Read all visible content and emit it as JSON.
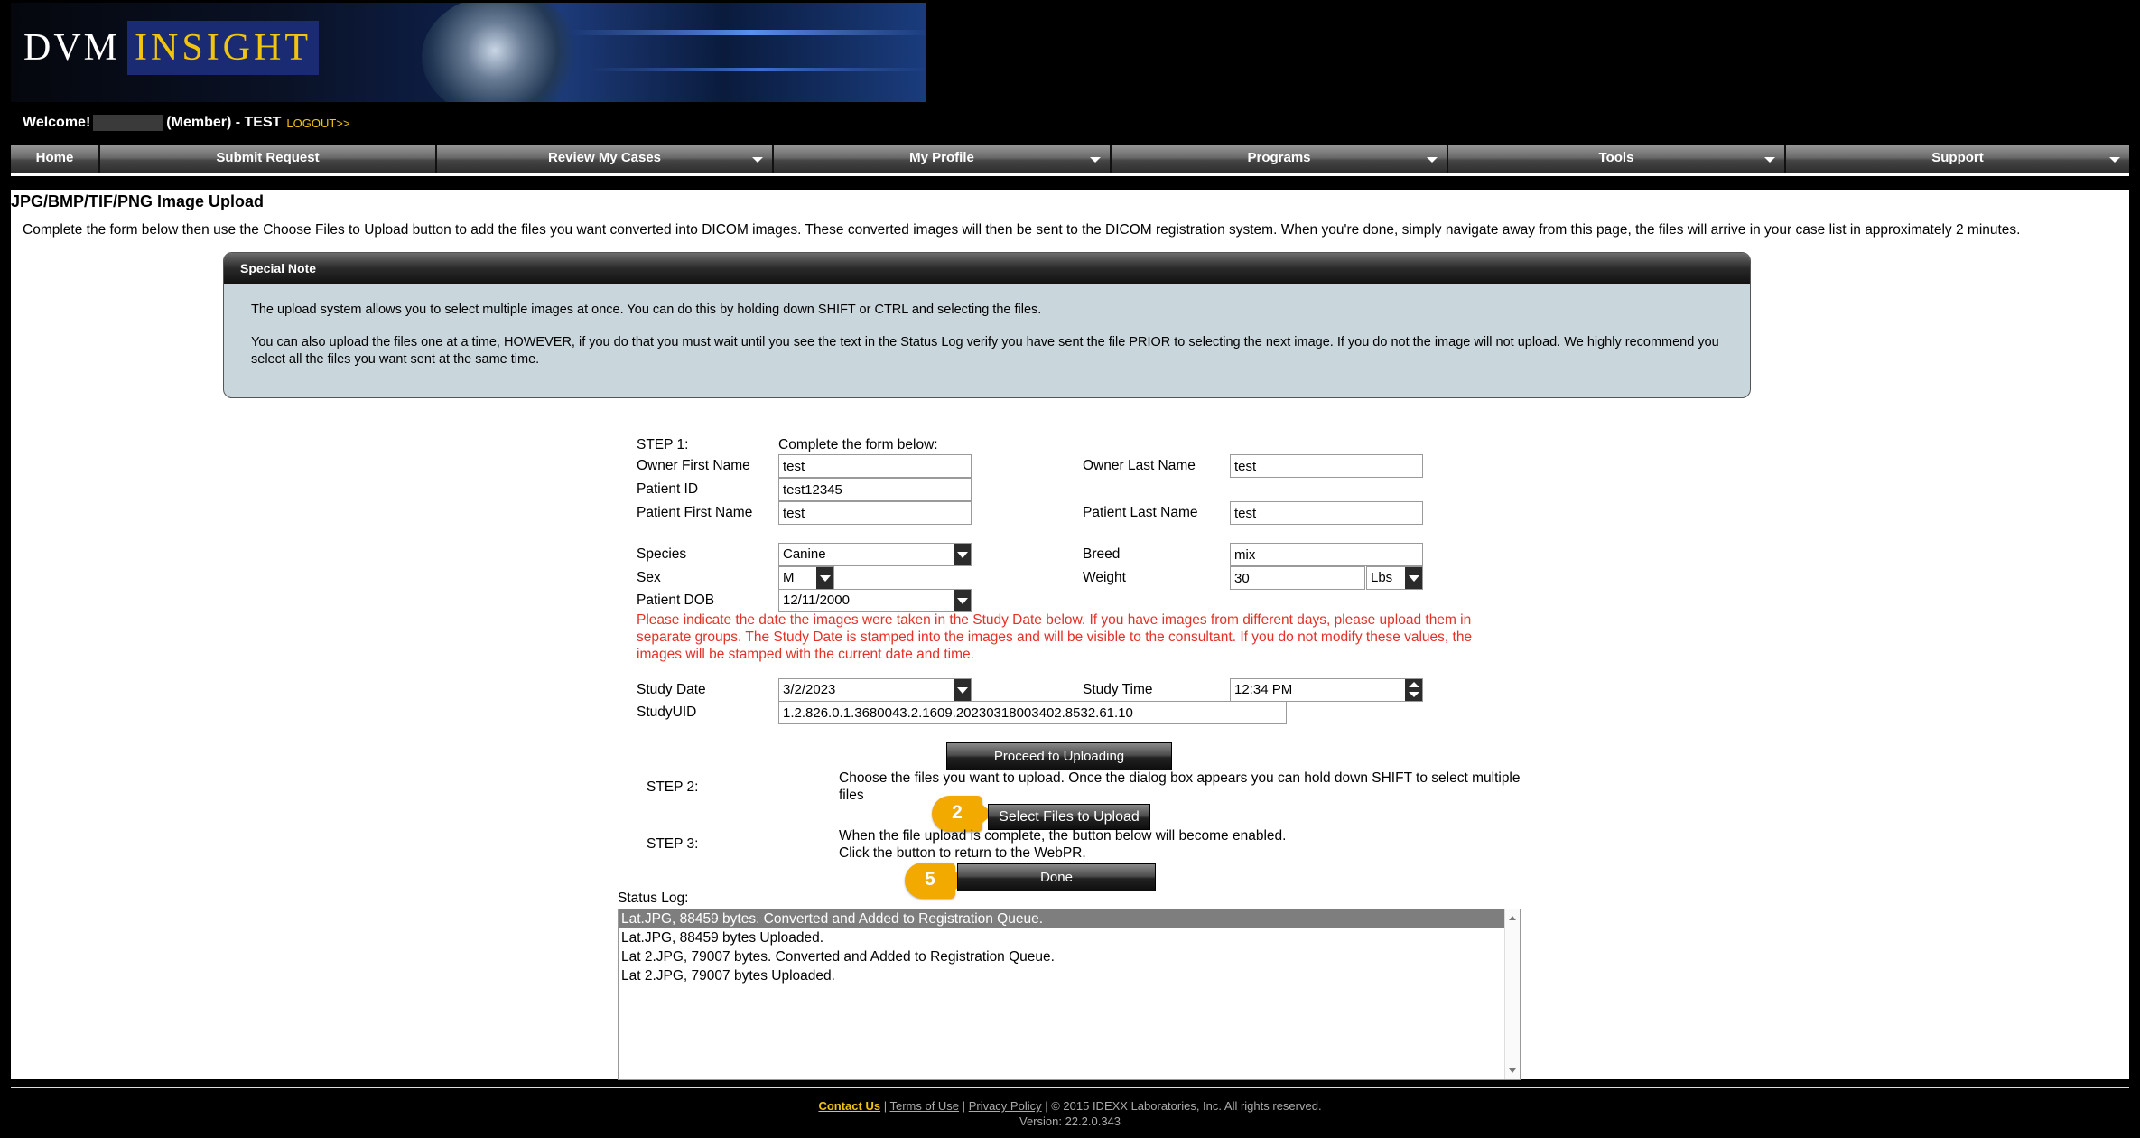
{
  "header": {
    "logo_left": "DVM",
    "logo_right": "INSIGHT",
    "welcome": "Welcome!",
    "member_text": "(Member) - TEST",
    "logout": "LOGOUT>>"
  },
  "nav": {
    "items": [
      {
        "label": "Home"
      },
      {
        "label": "Submit Request"
      },
      {
        "label": "Review My Cases"
      },
      {
        "label": "My Profile"
      },
      {
        "label": "Programs"
      },
      {
        "label": "Tools"
      },
      {
        "label": "Support"
      }
    ]
  },
  "page": {
    "title": "JPG/BMP/TIF/PNG Image Upload",
    "intro": "Complete the form below then use the Choose Files to Upload button to add the files you want converted into DICOM images. These converted images will then be sent to the DICOM registration system. When you're done, simply navigate away from this page, the files will arrive in your case list in approximately 2 minutes."
  },
  "note": {
    "title": "Special Note",
    "para1": "The upload system allows you to select multiple images at once. You can do this by holding down SHIFT or CTRL and selecting the files.",
    "para2": "You can also upload the files one at a time, HOWEVER, if you do that you must wait until you see the text in the Status Log verify you have sent the file PRIOR to selecting the next image. If you do not the image will not upload.   We highly recommend you select all the files you want sent at the same time."
  },
  "form": {
    "step1_label": "STEP 1:",
    "step1_text": "Complete the form below:",
    "owner_first_label": "Owner First Name",
    "owner_first_value": "test",
    "owner_last_label": "Owner Last Name",
    "owner_last_value": "test",
    "patient_id_label": "Patient ID",
    "patient_id_value": "test12345",
    "patient_first_label": "Patient First Name",
    "patient_first_value": "test",
    "patient_last_label": "Patient Last Name",
    "patient_last_value": "test",
    "species_label": "Species",
    "species_value": "Canine",
    "breed_label": "Breed",
    "breed_value": "mix",
    "sex_label": "Sex",
    "sex_value": "M",
    "weight_label": "Weight",
    "weight_value": "30",
    "weight_unit": "Lbs",
    "dob_label": "Patient DOB",
    "dob_value": "12/11/2000",
    "disclaimer": "Please indicate the date the images were taken in the Study Date below.  If you have images from different days, please upload them in separate groups. The Study Date is stamped into the images and will be visible to the consultant. If you do not modify these values, the images will be stamped with the current date and time.",
    "study_date_label": "Study Date",
    "study_date_value": "3/2/2023",
    "study_time_label": "Study Time",
    "study_time_value": "12:34 PM",
    "study_uid_label": "StudyUID",
    "study_uid_value": "1.2.826.0.1.3680043.2.1609.20230318003402.8532.61.10",
    "proceed_button": "Proceed to Uploading",
    "step2_label": "STEP 2:",
    "step2_text": "Choose the files you want to upload.  Once the dialog box appears you can hold down SHIFT to select multiple files",
    "select_button": "Select Files to Upload",
    "step3_label": "STEP 3:",
    "step3_text1": "When the file upload is complete, the button below will become enabled.",
    "step3_text2": "Click the button to return to the WebPR.",
    "done_button": "Done",
    "badge_select": "2",
    "badge_done": "5"
  },
  "status_log": {
    "label": "Status Log:",
    "lines": [
      "Lat.JPG, 88459 bytes. Converted and Added to Registration Queue.",
      "Lat.JPG, 88459 bytes Uploaded.",
      "Lat 2.JPG, 79007 bytes. Converted and Added to Registration Queue.",
      "Lat 2.JPG, 79007 bytes Uploaded."
    ]
  },
  "footer": {
    "contact": "Contact Us",
    "sep": "|",
    "terms": "Terms of Use",
    "privacy": "Privacy Policy",
    "copyright": "| © 2015 IDEXX Laboratories, Inc. All rights reserved.",
    "version": "Version: 22.2.0.343"
  },
  "colors": {
    "background": "#000000",
    "accent_gold": "#f1c40f",
    "warning_red": "#e53026",
    "badge_orange": "#f2a900",
    "note_bg": "#c9d6dc"
  }
}
